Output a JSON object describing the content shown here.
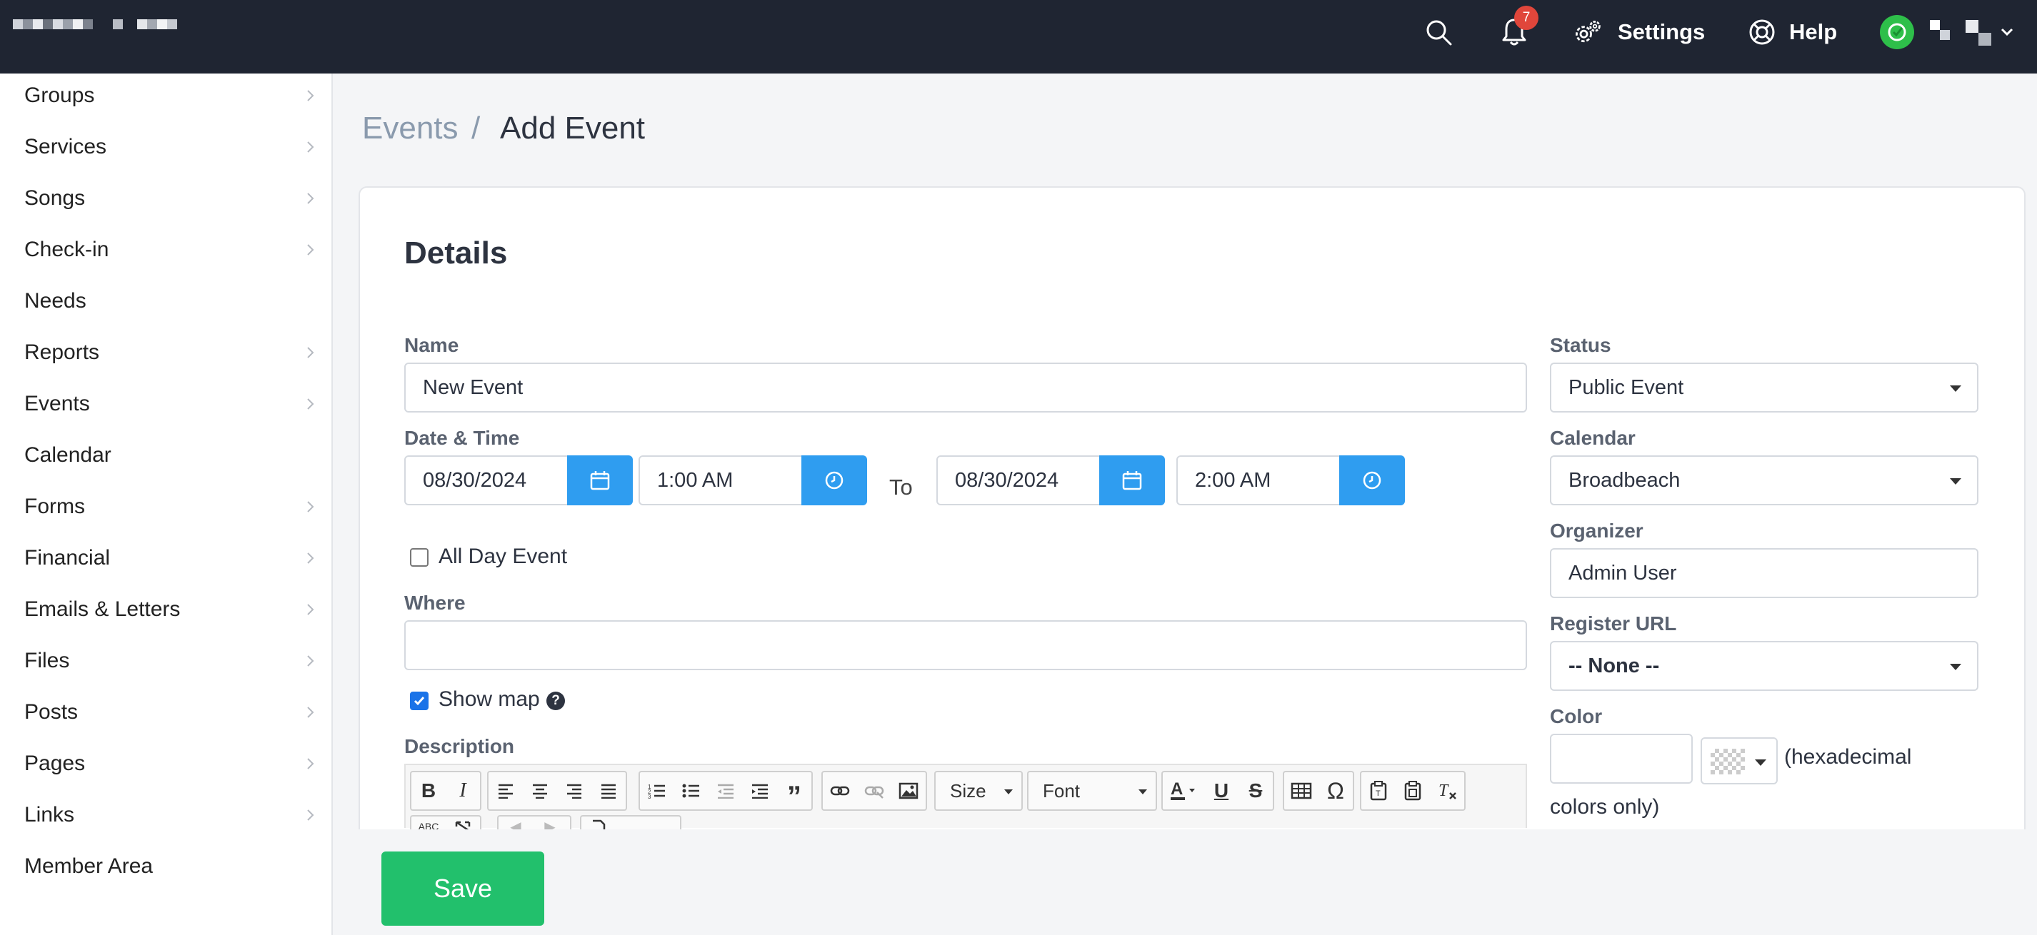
{
  "topbar": {
    "notifications_count": "7",
    "settings_label": "Settings",
    "help_label": "Help",
    "avatar_color": "#2ebf4a"
  },
  "sidebar": {
    "items": [
      {
        "label": "Groups",
        "chevron": true
      },
      {
        "label": "Services",
        "chevron": true
      },
      {
        "label": "Songs",
        "chevron": true
      },
      {
        "label": "Check-in",
        "chevron": true
      },
      {
        "label": "Needs",
        "chevron": false
      },
      {
        "label": "Reports",
        "chevron": true
      },
      {
        "label": "Events",
        "chevron": true
      },
      {
        "label": "Calendar",
        "chevron": false
      },
      {
        "label": "Forms",
        "chevron": true
      },
      {
        "label": "Financial",
        "chevron": true
      },
      {
        "label": "Emails & Letters",
        "chevron": true
      },
      {
        "label": "Files",
        "chevron": true
      },
      {
        "label": "Posts",
        "chevron": true
      },
      {
        "label": "Pages",
        "chevron": true
      },
      {
        "label": "Links",
        "chevron": true
      },
      {
        "label": "Member Area",
        "chevron": false
      }
    ]
  },
  "breadcrumb": {
    "parent": "Events",
    "separator": "/",
    "current": "Add Event"
  },
  "form": {
    "section_title": "Details",
    "name_label": "Name",
    "name_value": "New Event",
    "datetime_label": "Date & Time",
    "start_date": "08/30/2024",
    "start_time": "1:00 AM",
    "to_label": "To",
    "end_date": "08/30/2024",
    "end_time": "2:00 AM",
    "all_day_label": "All Day Event",
    "all_day_checked": false,
    "where_label": "Where",
    "where_value": "",
    "show_map_label": "Show map",
    "show_map_checked": true,
    "description_label": "Description",
    "status_label": "Status",
    "status_value": "Public Event",
    "calendar_label": "Calendar",
    "calendar_value": "Broadbeach",
    "organizer_label": "Organizer",
    "organizer_value": "Admin User",
    "register_url_label": "Register URL",
    "register_url_value": "-- None --",
    "color_label": "Color",
    "color_value": "",
    "color_note_line1": "(hexadecimal",
    "color_note_line2": "colors only)"
  },
  "editor": {
    "size_label": "Size",
    "font_label": "Font"
  },
  "actions": {
    "save_label": "Save",
    "save_color": "#22c06c",
    "accent_color": "#2f9df0"
  }
}
